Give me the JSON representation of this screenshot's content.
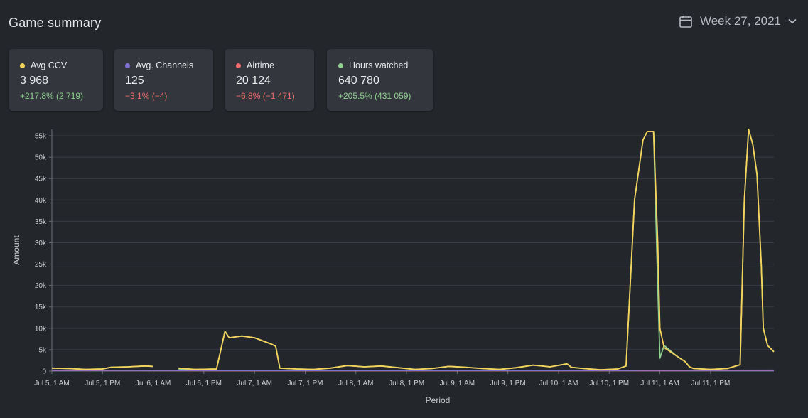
{
  "header": {
    "title": "Game summary",
    "week_label": "Week 27, 2021",
    "calendar_icon": "calendar-icon",
    "chevron_icon": "chevron-down-icon"
  },
  "cards": [
    {
      "label": "Avg CCV",
      "value": "3 968",
      "change": "+217.8% (2 719)",
      "dot_color": "#f6d35b",
      "change_color": "#8fd08f"
    },
    {
      "label": "Avg. Channels",
      "value": "125",
      "change": "−3.1% (−4)",
      "dot_color": "#7f6fd1",
      "change_color": "#ef6b6b"
    },
    {
      "label": "Airtime",
      "value": "20 124",
      "change": "−6.8% (−1 471)",
      "dot_color": "#ef6b6b",
      "change_color": "#ef6b6b"
    },
    {
      "label": "Hours watched",
      "value": "640 780",
      "change": "+205.5% (431 059)",
      "dot_color": "#8fd08f",
      "change_color": "#8fd08f"
    }
  ],
  "chart_data": {
    "type": "line",
    "xlabel": "Period",
    "ylabel": "Amount",
    "ylim": [
      0,
      56000
    ],
    "y_ticks": [
      0,
      5000,
      10000,
      15000,
      20000,
      25000,
      30000,
      35000,
      40000,
      45000,
      50000,
      55000
    ],
    "y_tick_labels": [
      "0",
      "5k",
      "10k",
      "15k",
      "20k",
      "25k",
      "30k",
      "35k",
      "40k",
      "45k",
      "50k",
      "55k"
    ],
    "x_range_hours": [
      0,
      161
    ],
    "x_ticks": [
      0,
      12,
      24,
      36,
      48,
      60,
      72,
      84,
      96,
      108,
      120,
      132,
      144
    ],
    "x_tick_labels": [
      "Jul 5, 1 AM",
      "Jul 5, 1 PM",
      "Jul 6, 1 AM",
      "Jul 6, 1 PM",
      "Jul 7, 1 AM",
      "Jul 7, 1 PM",
      "Jul 8, 1 AM",
      "Jul 8, 1 PM",
      "Jul 9, 1 AM",
      "Jul 9, 1 PM",
      "Jul 10, 1 AM",
      "Jul 10, 1 PM",
      "Jul 11, 1 AM",
      "Jul 11, 1 PM"
    ],
    "grid": true,
    "colors": {
      "grid": "#3a3d43",
      "axis_text": "#c9ccd0"
    },
    "series": [
      {
        "name": "Avg CCV",
        "color": "#f6d35b",
        "points": [
          [
            0,
            700
          ],
          [
            4,
            600
          ],
          [
            8,
            400
          ],
          [
            12,
            500
          ],
          [
            14,
            900
          ],
          [
            18,
            1000
          ],
          [
            22,
            1200
          ],
          [
            24,
            1100
          ],
          [
            null,
            null
          ],
          [
            30,
            700
          ],
          [
            34,
            400
          ],
          [
            39,
            500
          ],
          [
            41,
            9300
          ],
          [
            42,
            7800
          ],
          [
            45,
            8200
          ],
          [
            48,
            7800
          ],
          [
            52,
            6300
          ],
          [
            53,
            5800
          ],
          [
            54,
            700
          ],
          [
            58,
            500
          ],
          [
            62,
            400
          ],
          [
            66,
            700
          ],
          [
            70,
            1300
          ],
          [
            74,
            1000
          ],
          [
            78,
            1200
          ],
          [
            82,
            800
          ],
          [
            86,
            400
          ],
          [
            90,
            600
          ],
          [
            94,
            1100
          ],
          [
            98,
            900
          ],
          [
            102,
            600
          ],
          [
            106,
            400
          ],
          [
            110,
            800
          ],
          [
            114,
            1400
          ],
          [
            118,
            1000
          ],
          [
            122,
            1700
          ],
          [
            123,
            900
          ],
          [
            126,
            600
          ],
          [
            130,
            300
          ],
          [
            134,
            500
          ],
          [
            136,
            1200
          ],
          [
            138,
            40000
          ],
          [
            140,
            54000
          ],
          [
            141,
            56000
          ],
          [
            142.5,
            56000
          ],
          [
            143.5,
            30000
          ],
          [
            144,
            10000
          ],
          [
            145,
            5500
          ],
          [
            148,
            3500
          ],
          [
            150,
            2200
          ],
          [
            151,
            1000
          ],
          [
            152,
            600
          ],
          [
            156,
            400
          ],
          [
            160,
            600
          ],
          [
            163,
            1500
          ],
          [
            164,
            40000
          ],
          [
            165,
            56500
          ],
          [
            166,
            53000
          ],
          [
            167,
            46000
          ],
          [
            168,
            25000
          ],
          [
            168.5,
            10000
          ],
          [
            169.5,
            6000
          ],
          [
            171,
            4500
          ]
        ]
      },
      {
        "name": "Avg. Channels",
        "color": "#7f6fd1",
        "points": [
          [
            0,
            200
          ],
          [
            40,
            150
          ],
          [
            80,
            150
          ],
          [
            120,
            150
          ],
          [
            140,
            180
          ],
          [
            171,
            200
          ]
        ]
      },
      {
        "name": "Airtime",
        "color": "#ef6b6b",
        "points": [
          [
            0,
            150
          ],
          [
            40,
            120
          ],
          [
            80,
            120
          ],
          [
            120,
            120
          ],
          [
            140,
            140
          ],
          [
            171,
            150
          ]
        ]
      },
      {
        "name": "Hours watched",
        "color": "#8fd08f",
        "points": [
          [
            0,
            700
          ],
          [
            4,
            600
          ],
          [
            8,
            400
          ],
          [
            12,
            500
          ],
          [
            14,
            900
          ],
          [
            18,
            1000
          ],
          [
            22,
            1200
          ],
          [
            24,
            1100
          ],
          [
            null,
            null
          ],
          [
            30,
            500
          ],
          [
            34,
            400
          ],
          [
            39,
            500
          ],
          [
            41,
            9300
          ],
          [
            42,
            7800
          ],
          [
            45,
            8200
          ],
          [
            48,
            7800
          ],
          [
            52,
            6300
          ],
          [
            53,
            5800
          ],
          [
            54,
            700
          ],
          [
            58,
            500
          ],
          [
            62,
            400
          ],
          [
            66,
            700
          ],
          [
            70,
            1300
          ],
          [
            74,
            1000
          ],
          [
            78,
            1200
          ],
          [
            82,
            800
          ],
          [
            86,
            400
          ],
          [
            90,
            600
          ],
          [
            94,
            1100
          ],
          [
            98,
            900
          ],
          [
            102,
            600
          ],
          [
            106,
            400
          ],
          [
            110,
            800
          ],
          [
            114,
            1400
          ],
          [
            118,
            1000
          ],
          [
            122,
            1700
          ],
          [
            123,
            900
          ],
          [
            126,
            600
          ],
          [
            130,
            300
          ],
          [
            134,
            500
          ],
          [
            136,
            1200
          ],
          [
            138,
            40000
          ],
          [
            140,
            54000
          ],
          [
            141,
            56000
          ],
          [
            142.5,
            56000
          ],
          [
            143.5,
            20000
          ],
          [
            144,
            3000
          ],
          [
            145,
            6000
          ],
          [
            148,
            3500
          ],
          [
            150,
            2200
          ],
          [
            151,
            1000
          ],
          [
            152,
            600
          ],
          [
            156,
            400
          ],
          [
            160,
            600
          ],
          [
            163,
            1500
          ],
          [
            164,
            40000
          ],
          [
            165,
            56500
          ],
          [
            166,
            53000
          ],
          [
            167,
            46000
          ],
          [
            168,
            25000
          ],
          [
            168.5,
            10000
          ],
          [
            169.5,
            6000
          ],
          [
            171,
            4500
          ]
        ]
      }
    ]
  }
}
